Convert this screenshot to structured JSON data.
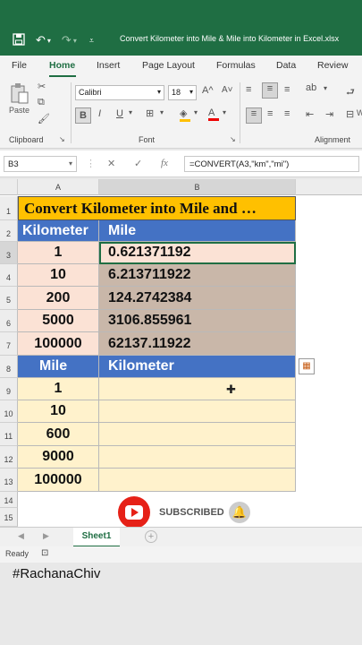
{
  "window": {
    "title": "Convert Kilometer into Mile & Mile into Kilometer in Excel.xlsx"
  },
  "ribbon_tabs": [
    "File",
    "Home",
    "Insert",
    "Page Layout",
    "Formulas",
    "Data",
    "Review"
  ],
  "ribbon": {
    "paste_label": "Paste",
    "font_name": "Calibri",
    "font_size": "18",
    "bold_label": "B",
    "italic_label": "I",
    "underline_label": "U",
    "grow_font": "A^",
    "shrink_font": "A˅",
    "font_color_glyph": "A",
    "clipboard_group": "Clipboard",
    "font_group": "Font",
    "alignment_group": "Alignment",
    "overflow_label": "W"
  },
  "formula_bar": {
    "name_box": "B3",
    "fx": "fx",
    "formula": "=CONVERT(A3,\"km\",\"mi\")"
  },
  "sheet": {
    "columns": [
      "A",
      "B"
    ],
    "rows": [
      "1",
      "2",
      "3",
      "4",
      "5",
      "6",
      "7",
      "8",
      "9",
      "10",
      "11",
      "12",
      "13",
      "14",
      "15"
    ],
    "title": "Convert Kilometer into Mile and …",
    "header1": {
      "a": "Kilometer",
      "b": "Mile"
    },
    "table1": [
      {
        "a": "1",
        "b": "0.621371192"
      },
      {
        "a": "10",
        "b": "6.213711922"
      },
      {
        "a": "200",
        "b": "124.2742384"
      },
      {
        "a": "5000",
        "b": "3106.855961"
      },
      {
        "a": "100000",
        "b": "62137.11922"
      }
    ],
    "header2": {
      "a": "Mile",
      "b": "Kilometer"
    },
    "table2": [
      {
        "a": "1",
        "b": ""
      },
      {
        "a": "10",
        "b": ""
      },
      {
        "a": "600",
        "b": ""
      },
      {
        "a": "9000",
        "b": ""
      },
      {
        "a": "100000",
        "b": ""
      }
    ]
  },
  "sheet_tabs": {
    "active": "Sheet1",
    "add": "+"
  },
  "status": {
    "ready": "Ready"
  },
  "overlay": {
    "subscribe_text": "SUBSCRIBED",
    "hashtag": "#RachanaChiv"
  },
  "colors": {
    "excel_green": "#1f6e43",
    "title_fill": "#ffc000",
    "header_blue": "#4472c4",
    "peach": "#fbe2d5",
    "taupe": "#c9b7a9",
    "cream": "#fff2cc",
    "youtube_red": "#e62117"
  }
}
